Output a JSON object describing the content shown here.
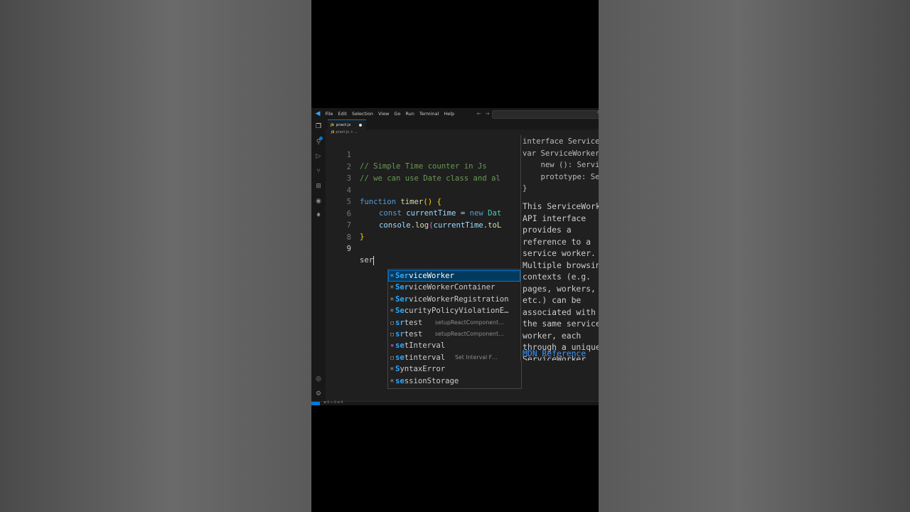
{
  "titlebar": {
    "menu": [
      "File",
      "Edit",
      "Selection",
      "View",
      "Go",
      "Run",
      "Terminal",
      "Help"
    ]
  },
  "activity_bar": [
    "files-icon",
    "search-icon",
    "run-debug-icon",
    "source-control-icon",
    "extensions-icon",
    "edge-icon",
    "mongodb-leaf-icon",
    "account-icon",
    "settings-gear-icon"
  ],
  "tab": {
    "filename": "pract.js",
    "js_badge": "JS",
    "modified": true
  },
  "breadcrumb": {
    "file": "pract.js",
    "rest": "> ..."
  },
  "editor": {
    "line_numbers": [
      "1",
      "2",
      "3",
      "4",
      "5",
      "6",
      "7",
      "8",
      "9"
    ],
    "current_line": 9,
    "lines": {
      "l1": "// Simple Time counter in Js",
      "l2": "// we can use Date class and al",
      "l4_kw": "function",
      "l4_fn": "timer",
      "l4_paren": "()",
      "l4_brace": "{",
      "l5_kw": "const",
      "l5_var": "currentTime",
      "l5_eq": " = ",
      "l5_new": "new",
      "l5_cls": "Dat",
      "l6_obj": "console",
      "l6_dot": ".",
      "l6_fn": "log",
      "l6_paren": "(",
      "l6_var": "currentTime",
      "l6_rest": ".toL",
      "l7_brace": "}",
      "l9_typed": "ser"
    }
  },
  "suggestions": [
    {
      "match": "Ser",
      "rest": "viceWorker",
      "detail": "",
      "icon": "interface-icon",
      "selected": true
    },
    {
      "match": "Ser",
      "rest": "viceWorkerContainer",
      "detail": "",
      "icon": "interface-icon"
    },
    {
      "match": "Ser",
      "rest": "viceWorkerRegistration",
      "detail": "",
      "icon": "interface-icon"
    },
    {
      "match": "Se",
      "rest": "curityPolicyViolationE…",
      "detail": "",
      "icon": "interface-icon"
    },
    {
      "match": "sr",
      "rest": "test",
      "detail": "setupReactComponent…",
      "icon": "snippet-icon"
    },
    {
      "match": "sr",
      "rest": "test",
      "detail": "setupReactComponent…",
      "icon": "snippet-icon"
    },
    {
      "match": "se",
      "rest": "tInterval",
      "detail": "",
      "icon": "function-icon"
    },
    {
      "match": "se",
      "rest": "tinterval",
      "detail": "Set Interval F…",
      "icon": "snippet-icon"
    },
    {
      "match": "S",
      "rest": "yntaxError",
      "detail": "",
      "icon": "interface-icon"
    },
    {
      "match": "se",
      "rest": "ssionStorage",
      "detail": "",
      "icon": "interface-icon"
    }
  ],
  "details": {
    "code": [
      "interface ServiceW…",
      "var ServiceWorker:…",
      "    new (): Servic…",
      "    prototype: Ser…",
      "}"
    ],
    "description": "This ServiceWorker API interface provides a reference to a service worker. Multiple browsing contexts (e.g. pages, workers, etc.) can be associated with the same service worker, each through a unique ServiceWorker object. Available only in secure contexts.",
    "link": "MDN Reference"
  },
  "statusbar": {
    "text": "⊗ 0 ⚠ 0   ⊘ 0"
  }
}
